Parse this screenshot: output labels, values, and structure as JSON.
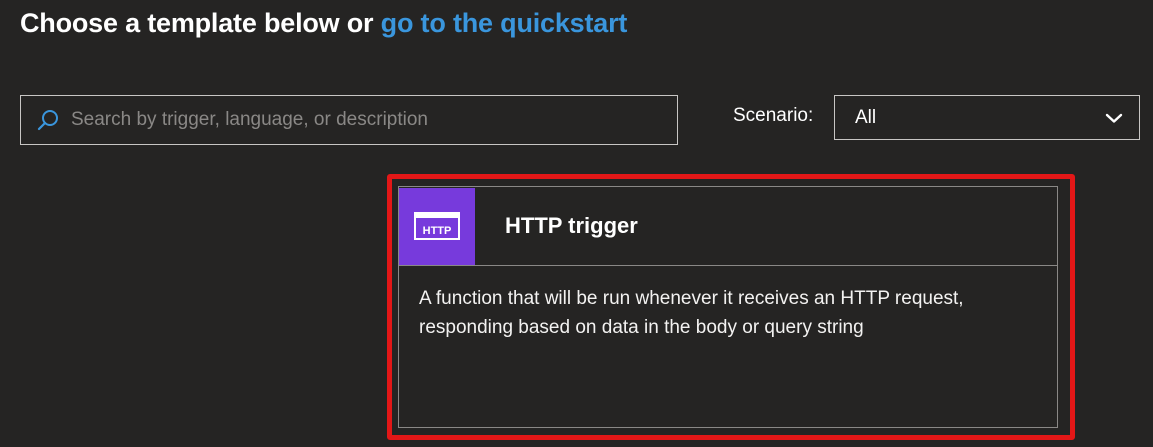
{
  "heading": {
    "text": "Choose a template below or ",
    "link": "go to the quickstart"
  },
  "search": {
    "placeholder": "Search by trigger, language, or description",
    "value": "",
    "icon": "search-icon"
  },
  "scenario": {
    "label": "Scenario:",
    "selected": "All",
    "icon": "chevron-down-icon"
  },
  "templates": [
    {
      "icon_label": "HTTP",
      "icon_color": "#773adc",
      "title": "HTTP trigger",
      "description": "A function that will be run whenever it receives an HTTP request, responding based on data in the body or query string"
    }
  ],
  "colors": {
    "background": "#252423",
    "link": "#3a96dd",
    "highlight": "#e31717",
    "border": "#8a8886"
  }
}
